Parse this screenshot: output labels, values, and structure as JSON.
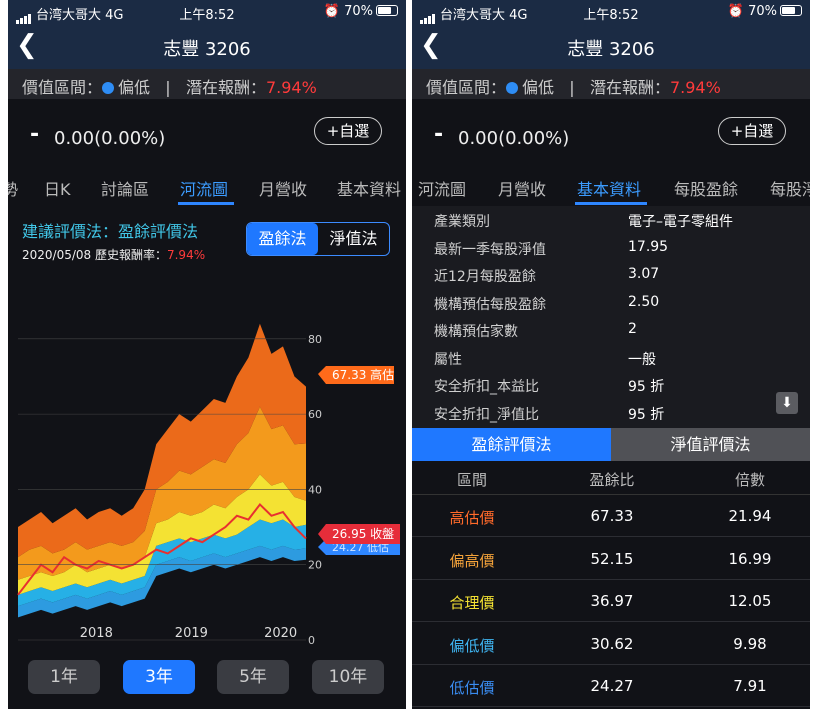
{
  "status": {
    "carrier": "台湾大哥大",
    "network": "4G",
    "time": "上午8:52",
    "battery": "70%"
  },
  "nav": {
    "title": "志豐 3206"
  },
  "valuation": {
    "label": "價值區間：",
    "level": "偏低",
    "sep": "|",
    "reward_label": "潛在報酬：",
    "reward": "7.94%"
  },
  "price": {
    "dash": "-",
    "value": "0.00(0.00%)",
    "watch": "+自選"
  },
  "tabs_left": [
    "勢",
    "日K",
    "討論區",
    "河流圖",
    "月營收",
    "基本資料"
  ],
  "tabs_right": [
    "河流圖",
    "月營收",
    "基本資料",
    "每股盈餘",
    "每股淨"
  ],
  "river": {
    "method_label": "建議評價法：盈餘評價法",
    "date_label": "2020/05/08 歷史報酬率：",
    "date_rate": "7.94%",
    "seg_a": "盈餘法",
    "seg_b": "淨值法",
    "high_tag": "67.33 高估",
    "close_tag": "26.95 收盤",
    "low_tag": "24.27 低估"
  },
  "chart_data": {
    "type": "area",
    "x_ticks": [
      "2018",
      "2019",
      "2020"
    ],
    "y_ticks": [
      0,
      20,
      40,
      60,
      80
    ],
    "ylim": [
      0,
      85
    ],
    "x": [
      0,
      0.04,
      0.08,
      0.12,
      0.16,
      0.2,
      0.24,
      0.28,
      0.32,
      0.36,
      0.4,
      0.44,
      0.48,
      0.52,
      0.56,
      0.6,
      0.64,
      0.68,
      0.72,
      0.76,
      0.8,
      0.84,
      0.88,
      0.92,
      0.96,
      1.0
    ],
    "bands": [
      {
        "name": "低估",
        "values": [
          9,
          10,
          11,
          10,
          11,
          12,
          11,
          12,
          13,
          12,
          13,
          14,
          20,
          21,
          22,
          21,
          22,
          23,
          22,
          23,
          24,
          25,
          24,
          25,
          24,
          24.3
        ]
      },
      {
        "name": "偏低",
        "values": [
          12,
          13,
          14,
          13,
          14,
          15,
          14,
          15,
          16,
          15,
          16,
          17,
          25,
          26,
          27,
          26,
          27,
          28,
          27,
          28,
          30,
          32,
          31,
          32,
          30,
          30.6
        ]
      },
      {
        "name": "合理",
        "values": [
          16,
          17,
          18,
          17,
          18,
          20,
          18,
          19,
          20,
          19,
          20,
          22,
          31,
          32,
          34,
          33,
          34,
          36,
          35,
          38,
          40,
          44,
          41,
          42,
          38,
          37.0
        ]
      },
      {
        "name": "偏高",
        "values": [
          22,
          24,
          25,
          23,
          24,
          26,
          24,
          25,
          26,
          25,
          26,
          29,
          40,
          42,
          45,
          44,
          46,
          48,
          47,
          52,
          55,
          62,
          56,
          57,
          52,
          52.2
        ]
      },
      {
        "name": "高估",
        "values": [
          30,
          32,
          34,
          31,
          33,
          35,
          32,
          34,
          35,
          33,
          35,
          40,
          52,
          56,
          60,
          58,
          61,
          64,
          63,
          70,
          75,
          84,
          76,
          78,
          70,
          67.3
        ]
      }
    ],
    "close": [
      12,
      16,
      20,
      18,
      22,
      20,
      19,
      21,
      20,
      19,
      20,
      22,
      24,
      23,
      25,
      27,
      26,
      28,
      30,
      33,
      32,
      36,
      33,
      34,
      30,
      26.95
    ],
    "colors": {
      "low": "#2d9be0",
      "mid_low": "#26b0e6",
      "fair": "#f4e233",
      "high": "#f39a1c",
      "top": "#eb6a1a",
      "close": "#e83030"
    }
  },
  "periods": [
    "1年",
    "3年",
    "5年",
    "10年"
  ],
  "info": [
    {
      "k": "產業類別",
      "v": "電子–電子零組件"
    },
    {
      "k": "最新一季每股淨值",
      "v": "17.95"
    },
    {
      "k": "近12月每股盈餘",
      "v": "3.07"
    },
    {
      "k": "機構預估每股盈餘",
      "v": "2.50"
    },
    {
      "k": "機構預估家數",
      "v": "2"
    },
    {
      "k": "屬性",
      "v": "一般"
    },
    {
      "k": "安全折扣_本益比",
      "v": "95 折"
    },
    {
      "k": "安全折扣_淨值比",
      "v": "95 折"
    }
  ],
  "method_tabs": {
    "a": "盈餘評價法",
    "b": "淨值評價法"
  },
  "table": {
    "headers": [
      "區間",
      "盈餘比",
      "倍數"
    ],
    "rows": [
      {
        "name": "高估價",
        "price": "67.33",
        "mult": "21.94",
        "color": "#ff6a2a"
      },
      {
        "name": "偏高價",
        "price": "52.15",
        "mult": "16.99",
        "color": "#f3a23a"
      },
      {
        "name": "合理價",
        "price": "36.97",
        "mult": "12.05",
        "color": "#f4e233"
      },
      {
        "name": "偏低價",
        "price": "30.62",
        "mult": "9.98",
        "color": "#3fb4f0"
      },
      {
        "name": "低估價",
        "price": "24.27",
        "mult": "7.91",
        "color": "#3a8cf0"
      }
    ]
  }
}
